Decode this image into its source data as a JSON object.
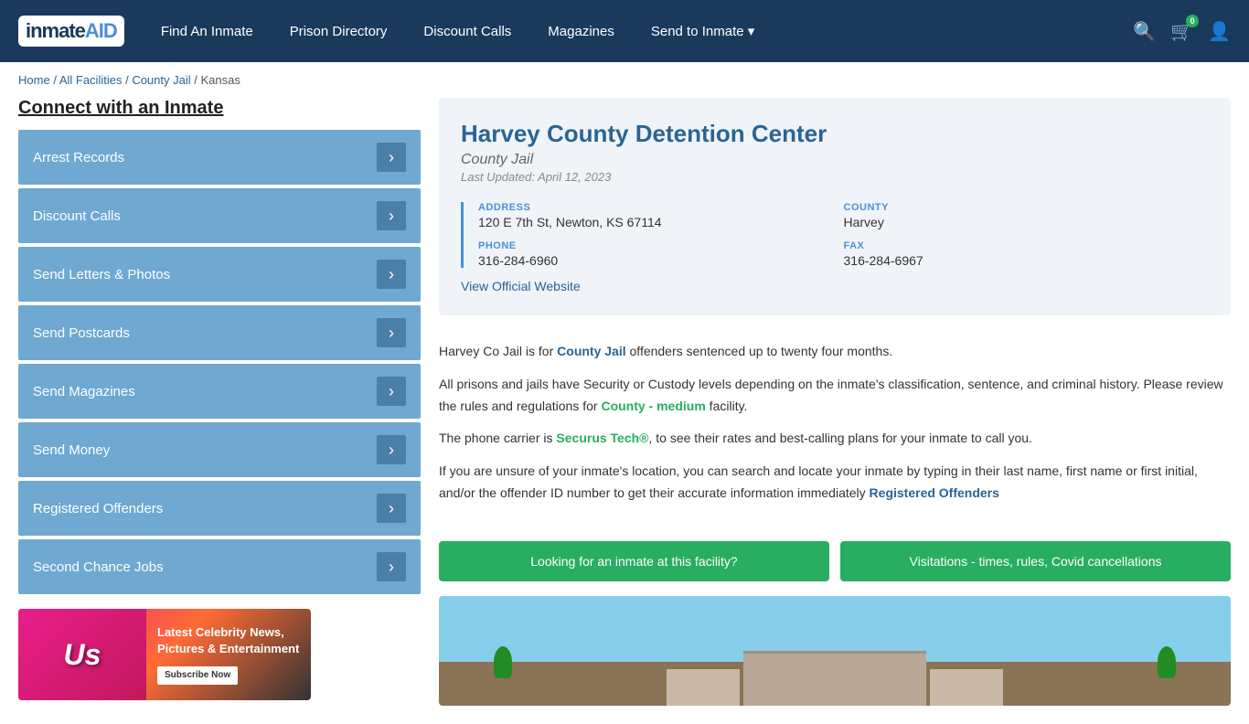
{
  "site": {
    "logo_main": "inmate",
    "logo_accent": "AID",
    "logo_symbol": "🎓"
  },
  "nav": {
    "links": [
      {
        "label": "Find An Inmate",
        "id": "find-an-inmate"
      },
      {
        "label": "Prison Directory",
        "id": "prison-directory"
      },
      {
        "label": "Discount Calls",
        "id": "discount-calls"
      },
      {
        "label": "Magazines",
        "id": "magazines"
      },
      {
        "label": "Send to Inmate ▾",
        "id": "send-to-inmate"
      }
    ],
    "cart_count": "0"
  },
  "breadcrumb": {
    "items": [
      "Home",
      "All Facilities",
      "County Jail",
      "Kansas"
    ],
    "separators": " / "
  },
  "sidebar": {
    "title": "Connect with an Inmate",
    "menu_items": [
      {
        "label": "Arrest Records",
        "id": "arrest-records"
      },
      {
        "label": "Discount Calls",
        "id": "discount-calls"
      },
      {
        "label": "Send Letters & Photos",
        "id": "send-letters-photos"
      },
      {
        "label": "Send Postcards",
        "id": "send-postcards"
      },
      {
        "label": "Send Magazines",
        "id": "send-magazines"
      },
      {
        "label": "Send Money",
        "id": "send-money"
      },
      {
        "label": "Registered Offenders",
        "id": "registered-offenders"
      },
      {
        "label": "Second Chance Jobs",
        "id": "second-chance-jobs"
      }
    ]
  },
  "ad": {
    "brand": "Us",
    "headline": "Latest Celebrity News, Pictures & Entertainment",
    "cta": "Subscribe Now"
  },
  "facility": {
    "name": "Harvey County Detention Center",
    "type": "County Jail",
    "last_updated": "Last Updated: April 12, 2023",
    "address_label": "ADDRESS",
    "address_value": "120 E 7th St, Newton, KS 67114",
    "county_label": "COUNTY",
    "county_value": "Harvey",
    "phone_label": "PHONE",
    "phone_value": "316-284-6960",
    "fax_label": "FAX",
    "fax_value": "316-284-6967",
    "website_link": "View Official Website",
    "desc1": "Harvey Co Jail is for ",
    "desc1_link": "County Jail",
    "desc1_rest": " offenders sentenced up to twenty four months.",
    "desc2": "All prisons and jails have Security or Custody levels depending on the inmate's classification, sentence, and criminal history. Please review the rules and regulations for ",
    "desc2_link": "County - medium",
    "desc2_rest": " facility.",
    "desc3_pre": "The phone carrier is ",
    "desc3_link": "Securus Tech®",
    "desc3_post": ", to see their rates and best-calling plans for your inmate to call you.",
    "desc4": "If you are unsure of your inmate's location, you can search and locate your inmate by typing in their last name, first name or first initial, and/or the offender ID number to get their accurate information immediately ",
    "desc4_link": "Registered Offenders",
    "btn_find": "Looking for an inmate at this facility?",
    "btn_visit": "Visitations - times, rules, Covid cancellations"
  }
}
